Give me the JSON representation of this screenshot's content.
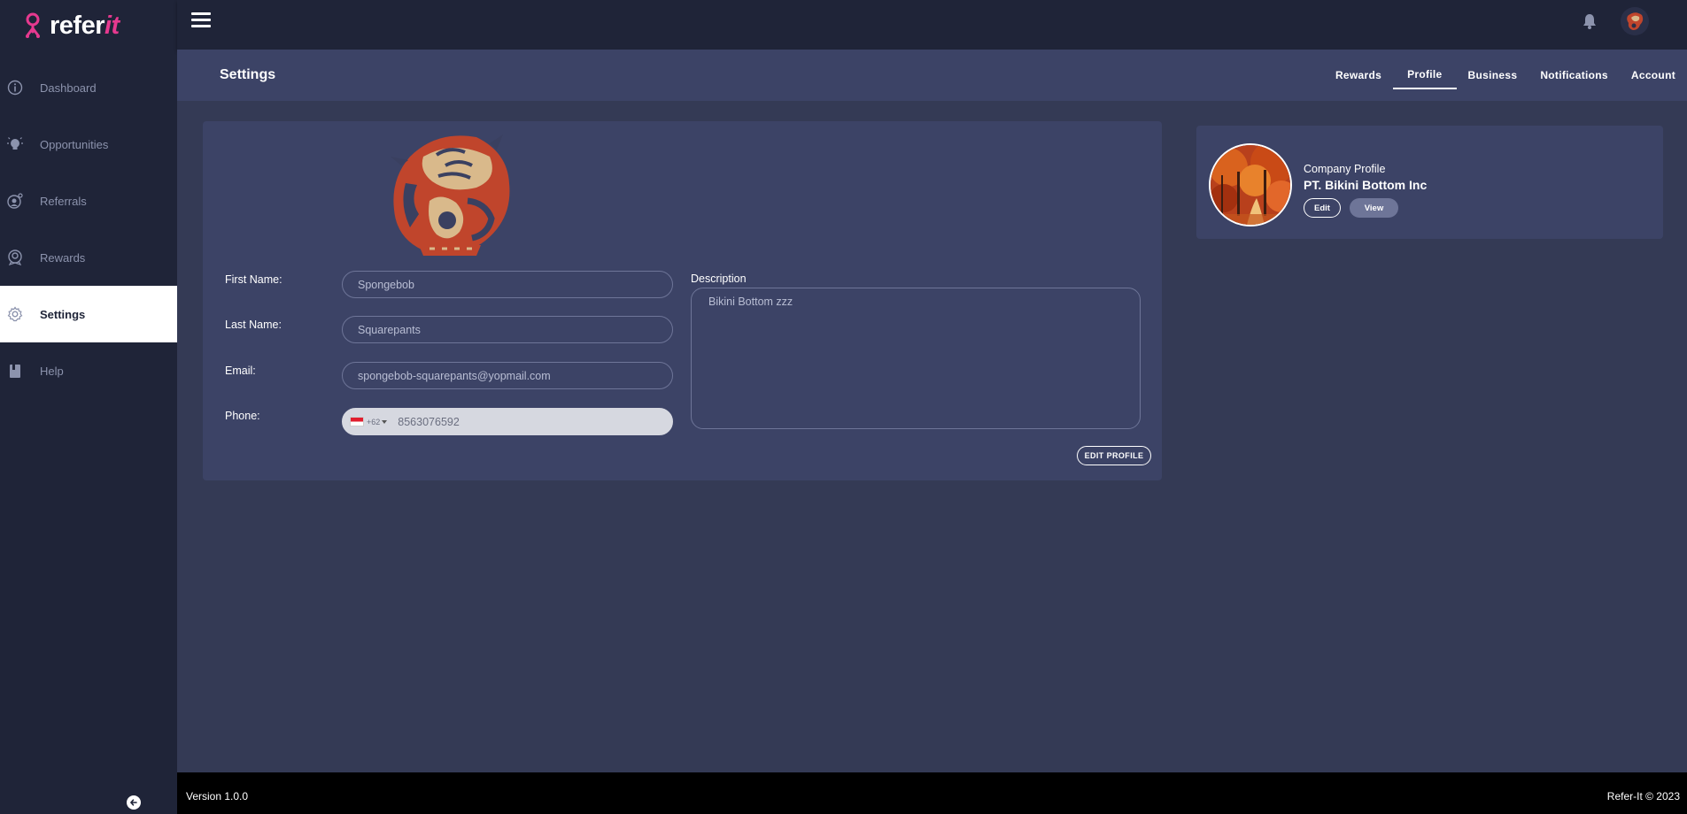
{
  "brand": {
    "name_main": "refer",
    "name_accent": "it",
    "accent_color": "#e6398f"
  },
  "sidebar": {
    "items": [
      {
        "label": "Dashboard",
        "icon": "info-circle-icon"
      },
      {
        "label": "Opportunities",
        "icon": "lightbulb-icon"
      },
      {
        "label": "Referrals",
        "icon": "referral-icon"
      },
      {
        "label": "Rewards",
        "icon": "award-icon"
      },
      {
        "label": "Settings",
        "icon": "gear-icon",
        "active": true
      },
      {
        "label": "Help",
        "icon": "book-icon"
      }
    ]
  },
  "header": {
    "title": "Settings"
  },
  "tabs": [
    {
      "label": "Rewards"
    },
    {
      "label": "Profile",
      "active": true
    },
    {
      "label": "Business"
    },
    {
      "label": "Notifications"
    },
    {
      "label": "Account"
    }
  ],
  "profile": {
    "first_name_label": "First Name:",
    "first_name": "Spongebob",
    "last_name_label": "Last Name:",
    "last_name": "Squarepants",
    "email_label": "Email:",
    "email": "spongebob-squarepants@yopmail.com",
    "phone_label": "Phone:",
    "phone_dial": "+62",
    "phone": "8563076592",
    "description_label": "Description",
    "description": "Bikini Bottom zzz",
    "edit_button": "EDIT PROFILE"
  },
  "company": {
    "label": "Company Profile",
    "name": "PT. Bikini Bottom Inc",
    "edit_button": "Edit",
    "view_button": "View"
  },
  "footer": {
    "version": "Version 1.0.0",
    "copyright": "Refer-It © 2023"
  }
}
